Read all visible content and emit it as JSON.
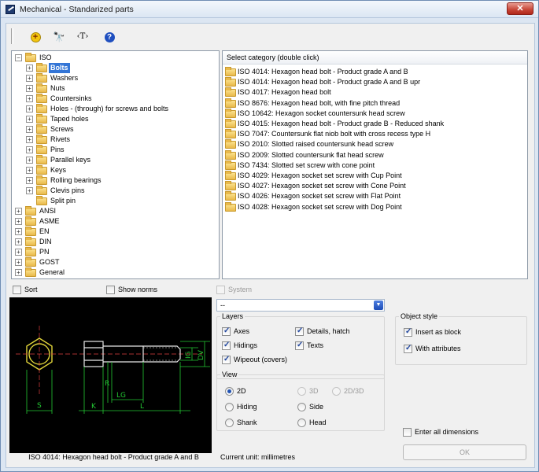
{
  "window": {
    "title": "Mechanical - Standarized parts",
    "close_glyph": "✕"
  },
  "toolbar": {
    "add_glyph": "+",
    "find_glyph": "🔭",
    "text_glyph": "‹T›",
    "help_glyph": "?"
  },
  "tree": {
    "items": [
      {
        "label": "ISO",
        "level": 0,
        "expander": "−",
        "selected": false
      },
      {
        "label": "Bolts",
        "level": 1,
        "expander": "+",
        "selected": true
      },
      {
        "label": "Washers",
        "level": 1,
        "expander": "+",
        "selected": false
      },
      {
        "label": "Nuts",
        "level": 1,
        "expander": "+",
        "selected": false
      },
      {
        "label": "Countersinks",
        "level": 1,
        "expander": "+",
        "selected": false
      },
      {
        "label": "Holes - (through) for screws and bolts",
        "level": 1,
        "expander": "+",
        "selected": false
      },
      {
        "label": "Taped holes",
        "level": 1,
        "expander": "+",
        "selected": false
      },
      {
        "label": "Screws",
        "level": 1,
        "expander": "+",
        "selected": false
      },
      {
        "label": "Rivets",
        "level": 1,
        "expander": "+",
        "selected": false
      },
      {
        "label": "Pins",
        "level": 1,
        "expander": "+",
        "selected": false
      },
      {
        "label": "Parallel keys",
        "level": 1,
        "expander": "+",
        "selected": false
      },
      {
        "label": "Keys",
        "level": 1,
        "expander": "+",
        "selected": false
      },
      {
        "label": "Rolling bearings",
        "level": 1,
        "expander": "+",
        "selected": false
      },
      {
        "label": "Clevis pins",
        "level": 1,
        "expander": "+",
        "selected": false
      },
      {
        "label": "Split pin",
        "level": 1,
        "expander": "",
        "selected": false
      },
      {
        "label": "ANSI",
        "level": 0,
        "expander": "+",
        "selected": false
      },
      {
        "label": "ASME",
        "level": 0,
        "expander": "+",
        "selected": false
      },
      {
        "label": "EN",
        "level": 0,
        "expander": "+",
        "selected": false
      },
      {
        "label": "DIN",
        "level": 0,
        "expander": "+",
        "selected": false
      },
      {
        "label": "PN",
        "level": 0,
        "expander": "+",
        "selected": false
      },
      {
        "label": "GOST",
        "level": 0,
        "expander": "+",
        "selected": false
      },
      {
        "label": "General",
        "level": 0,
        "expander": "+",
        "selected": false
      }
    ]
  },
  "list": {
    "header": "Select category (double click)",
    "items": [
      "ISO 4014: Hexagon head bolt - Product grade A and B",
      "ISO 4014: Hexagon head bolt - Product grade A and B upr",
      "ISO 4017: Hexagon head bolt",
      "ISO 8676: Hexagon head bolt, with fine pitch thread",
      "ISO 10642: Hexagon socket countersunk head screw",
      "ISO 4015: Hexagon head bolt - Product grade B - Reduced shank",
      "ISO 7047: Countersunk flat niob bolt with cross recess type H",
      "ISO 2010: Slotted raised countersunk head screw",
      "ISO 2009: Slotted countersunk flat head screw",
      "ISO 7434: Slotted set screw with cone point",
      "ISO 4029: Hexagon socket set screw with Cup Point",
      "ISO 4027: Hexagon socket set screw with Cone Point",
      "ISO 4026: Hexagon socket set screw with Flat Point",
      "ISO 4028: Hexagon socket set screw with Dog Point"
    ]
  },
  "options": {
    "sort_label": "Sort",
    "sort_checked": false,
    "show_norms_label": "Show norms",
    "show_norms_checked": false,
    "system_label": "System",
    "system_checked": false,
    "combo_value": "--",
    "combo_glyph": "▼"
  },
  "preview": {
    "caption": "ISO 4014: Hexagon head bolt - Product grade A and B",
    "dims": {
      "s": "S",
      "k": "K",
      "lg": "LG",
      "l": "L",
      "r": "R",
      "ig": "IG",
      "dv": "DV"
    }
  },
  "layers": {
    "title": "Layers",
    "axes": "Axes",
    "axes_checked": true,
    "details": "Details, hatch",
    "details_checked": true,
    "hidings": "Hidings",
    "hidings_checked": true,
    "texts": "Texts",
    "texts_checked": true,
    "wipeout": "Wipeout (covers)",
    "wipeout_checked": true
  },
  "view": {
    "title": "View",
    "opt_2d": "2D",
    "opt_3d": "3D",
    "opt_2d3d": "2D/3D",
    "hiding": "Hiding",
    "side": "Side",
    "shank": "Shank",
    "head": "Head",
    "selected": "2D"
  },
  "object_style": {
    "title": "Object style",
    "insert_as_block": "Insert as block",
    "insert_checked": true,
    "with_attributes": "With attributes",
    "attributes_checked": true
  },
  "footer": {
    "enter_all_dimensions": "Enter all dimensions",
    "enter_all_checked": false,
    "current_unit": "Current unit: millimetres",
    "ok_label": "OK"
  },
  "colors": {
    "drawing_line": "#e8e8e8",
    "dimension": "#23c933",
    "centerline": "#e04040",
    "hex_head": "#e0d43a",
    "selection": "#3375d6"
  }
}
